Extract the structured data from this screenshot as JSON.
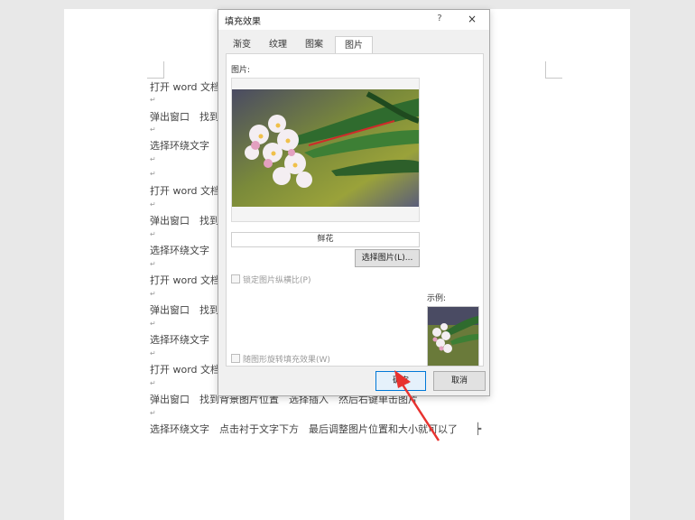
{
  "document": {
    "lines": [
      "打开 word 文档",
      "弹出窗口　找到",
      "选择环绕文字",
      "打开 word 文档",
      "弹出窗口　找到",
      "选择环绕文字",
      "打开 word 文档",
      "弹出窗口　找到",
      "选择环绕文字",
      "打开 word 文档",
      "弹出窗口　找到背景图片位置　选择插入　然后右键单击图片",
      "选择环绕文字　点击衬于文字下方　最后调整图片位置和大小就可以了"
    ],
    "paragraph_mark": "↵"
  },
  "dialog": {
    "title": "填充效果",
    "help": "?",
    "close": "×",
    "tabs": [
      "渐变",
      "纹理",
      "图案",
      "图片"
    ],
    "active_tab": "图片",
    "picture_label": "图片:",
    "picture_name": "鲜花",
    "select_picture_button": "选择图片(L)...",
    "lock_aspect_label": "锁定图片纵横比(P)",
    "rotate_with_shape_label": "随图形旋转填充效果(W)",
    "sample_label": "示例:",
    "ok_button": "确定",
    "cancel_button": "取消"
  },
  "colors": {
    "accent": "#0078d7",
    "arrow": "#e8322f"
  }
}
